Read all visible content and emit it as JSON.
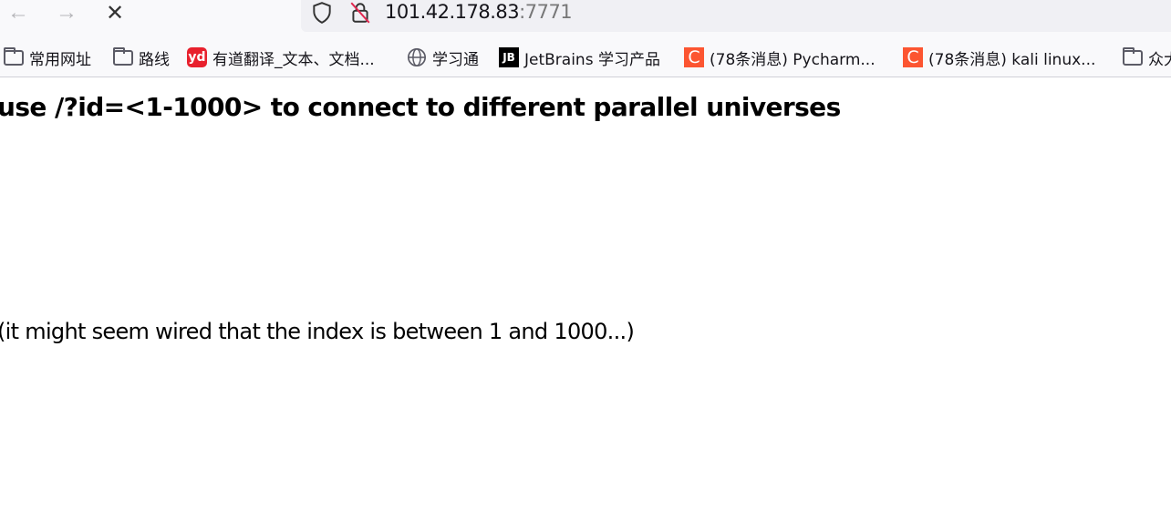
{
  "browser": {
    "url_host": "101.42.178.83",
    "url_port": ":7771",
    "bookmarks": [
      {
        "label": "常用网址",
        "icon": "folder-icon"
      },
      {
        "label": "路线",
        "icon": "folder-icon"
      },
      {
        "label": "有道翻译_文本、文档...",
        "icon": "youdao-icon",
        "icon_text": "yd",
        "color": "#e8202d"
      },
      {
        "label": "学习通",
        "icon": "globe-icon"
      },
      {
        "label": "JetBrains 学习产品",
        "icon": "jetbrains-icon",
        "icon_text": "JB",
        "color": "#000000"
      },
      {
        "label": "(78条消息) Pycharm...",
        "icon": "csdn-icon",
        "icon_text": "C",
        "color": "#fc5531"
      },
      {
        "label": "(78条消息) kali linux...",
        "icon": "csdn-icon",
        "icon_text": "C",
        "color": "#fc5531"
      },
      {
        "label": "众大",
        "icon": "folder-icon"
      }
    ]
  },
  "page": {
    "heading": "use /?id=<1-1000> to connect to different parallel universes",
    "note": "(it might seem wired that the index is between 1 and 1000...)"
  }
}
